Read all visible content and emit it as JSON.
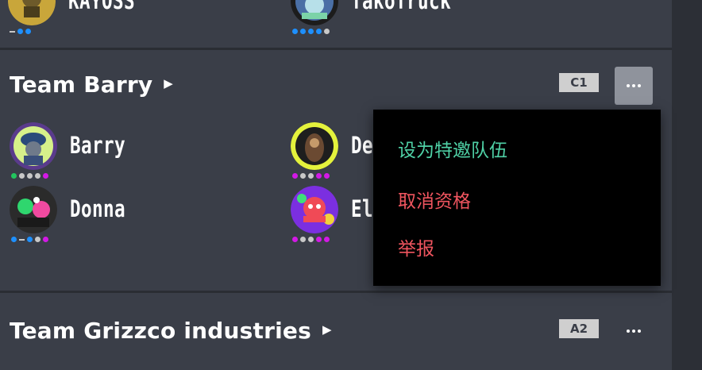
{
  "top_players": [
    {
      "name": "KAYOSS",
      "dots": [
        "dash",
        "blue",
        "blue"
      ]
    },
    {
      "name": "TakoTruck",
      "dots": [
        "blue",
        "blue",
        "blue",
        "blue",
        "gray"
      ]
    }
  ],
  "teams": [
    {
      "name": "Team Barry",
      "badge": "C1",
      "players": [
        {
          "name": "Barry",
          "dots": [
            "green",
            "gray",
            "gray",
            "gray",
            "magenta"
          ]
        },
        {
          "name": "Derek",
          "dots": [
            "magenta",
            "gray",
            "gray",
            "magenta",
            "magenta"
          ]
        },
        {
          "name": "Donna",
          "dots": [
            "blue",
            "dash",
            "blue",
            "gray",
            "magenta"
          ]
        },
        {
          "name": "Eli",
          "dots": [
            "magenta",
            "gray",
            "gray",
            "magenta",
            "magenta"
          ]
        }
      ]
    },
    {
      "name": "Team Grizzco industries",
      "badge": "A2"
    }
  ],
  "context_menu": {
    "items": [
      {
        "label": "设为特邀队伍",
        "color": "#4fd1a6"
      },
      {
        "label": "取消资格",
        "color": "#f0555f"
      },
      {
        "label": "举报",
        "color": "#f0555f"
      }
    ]
  },
  "colors": {
    "background": "#3a3e48",
    "badge": "#cfcfcf",
    "dot_blue": "#1e90ff",
    "dot_green": "#22c55e",
    "dot_gray": "#c8c8c8",
    "dot_magenta": "#d319e6"
  }
}
